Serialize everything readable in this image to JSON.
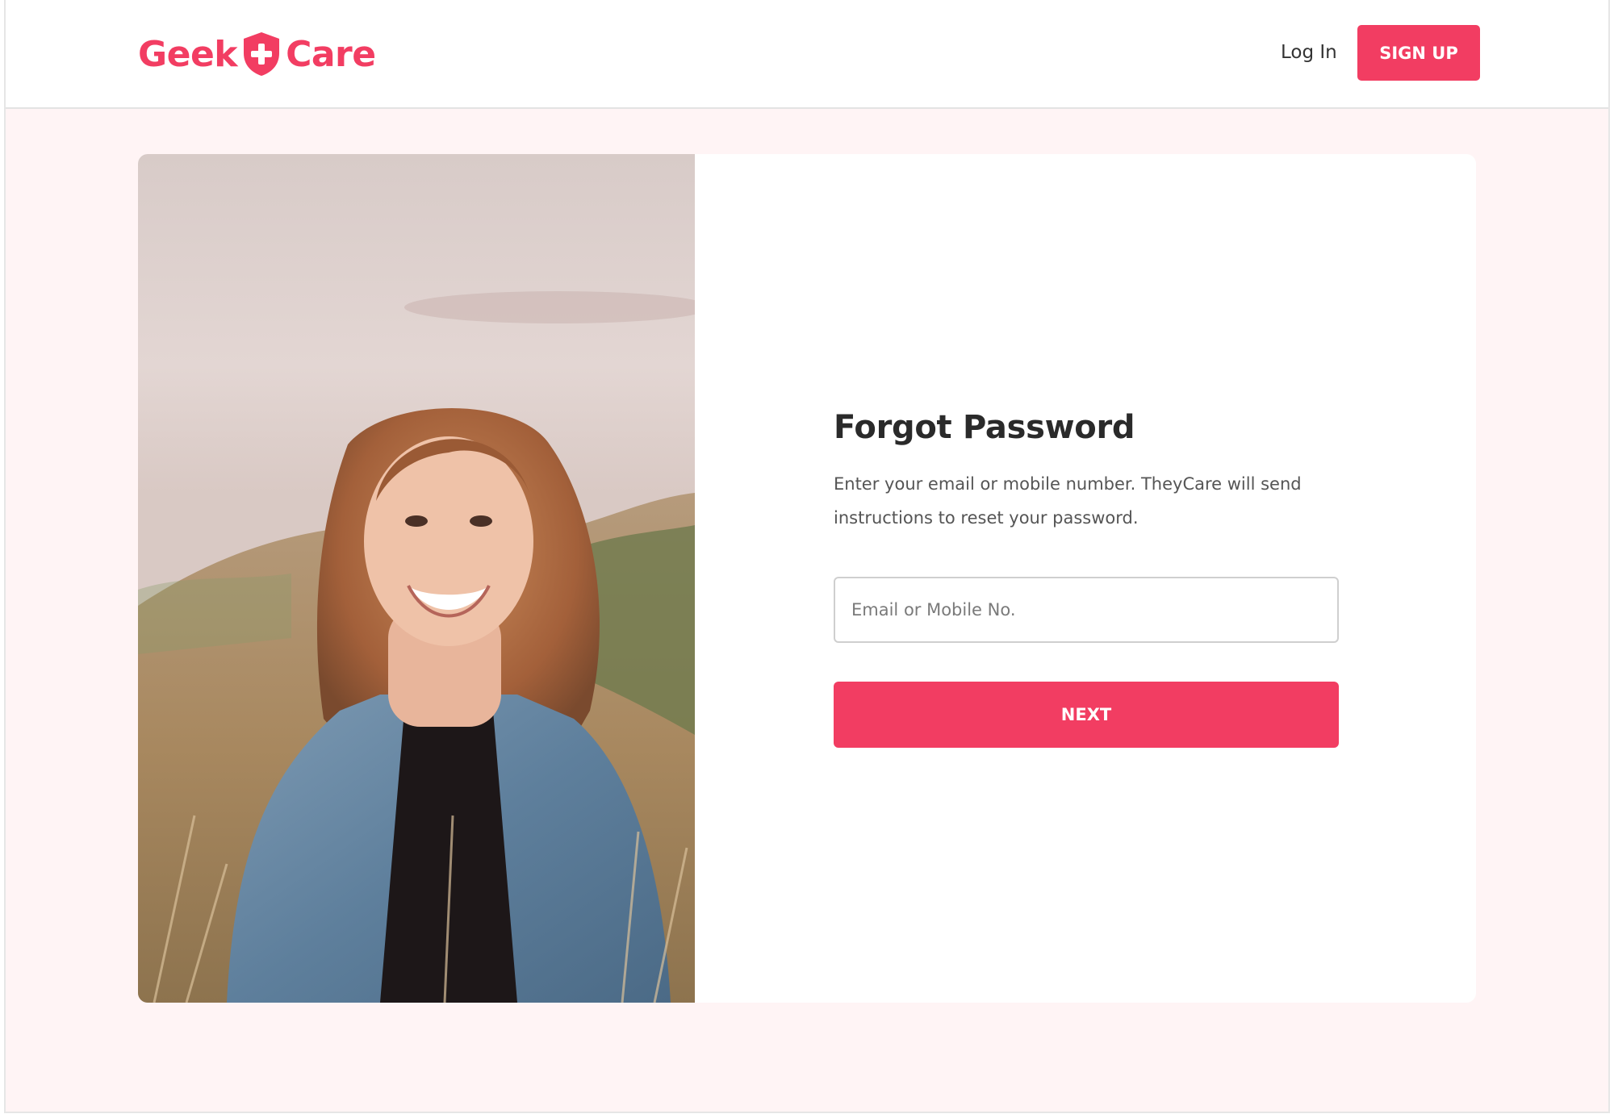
{
  "brand": {
    "name_part1": "Geek",
    "name_part2": "Care",
    "logo_icon": "shield-plus-icon",
    "accent_color": "#f23d62"
  },
  "header": {
    "login_label": "Log In",
    "signup_label": "SIGN UP"
  },
  "hero": {
    "image_subject": "smiling woman in denim jacket in a grassy field"
  },
  "form": {
    "title": "Forgot Password",
    "description": "Enter your email or mobile number. TheyCare will send instructions to reset your password.",
    "input_placeholder": "Email or Mobile No.",
    "input_value": "",
    "submit_label": "NEXT"
  }
}
